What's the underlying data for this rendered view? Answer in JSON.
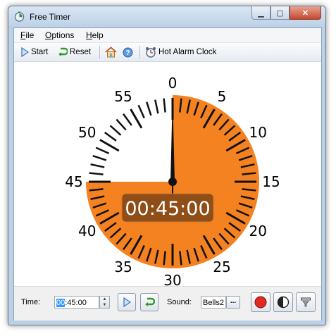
{
  "window": {
    "title": "Free Timer"
  },
  "menu": [
    {
      "accel": "F",
      "rest": "ile"
    },
    {
      "accel": "O",
      "rest": "ptions"
    },
    {
      "accel": "H",
      "rest": "elp"
    }
  ],
  "toolbar": {
    "start_label": "Start",
    "reset_label": "Reset",
    "alarm_label": "Hot Alarm Clock"
  },
  "dial": {
    "display": "00:45:00",
    "minute_labels": [
      "0",
      "5",
      "10",
      "15",
      "20",
      "25",
      "30",
      "35",
      "40",
      "45",
      "50",
      "55"
    ],
    "remaining_minutes": 45,
    "accent_color": "#f58220"
  },
  "controls": {
    "time_label": "Time:",
    "time_hours": "00",
    "time_rest": ":45:00",
    "sound_label": "Sound:",
    "sound_value": "Bells2",
    "browse_label": "..."
  }
}
